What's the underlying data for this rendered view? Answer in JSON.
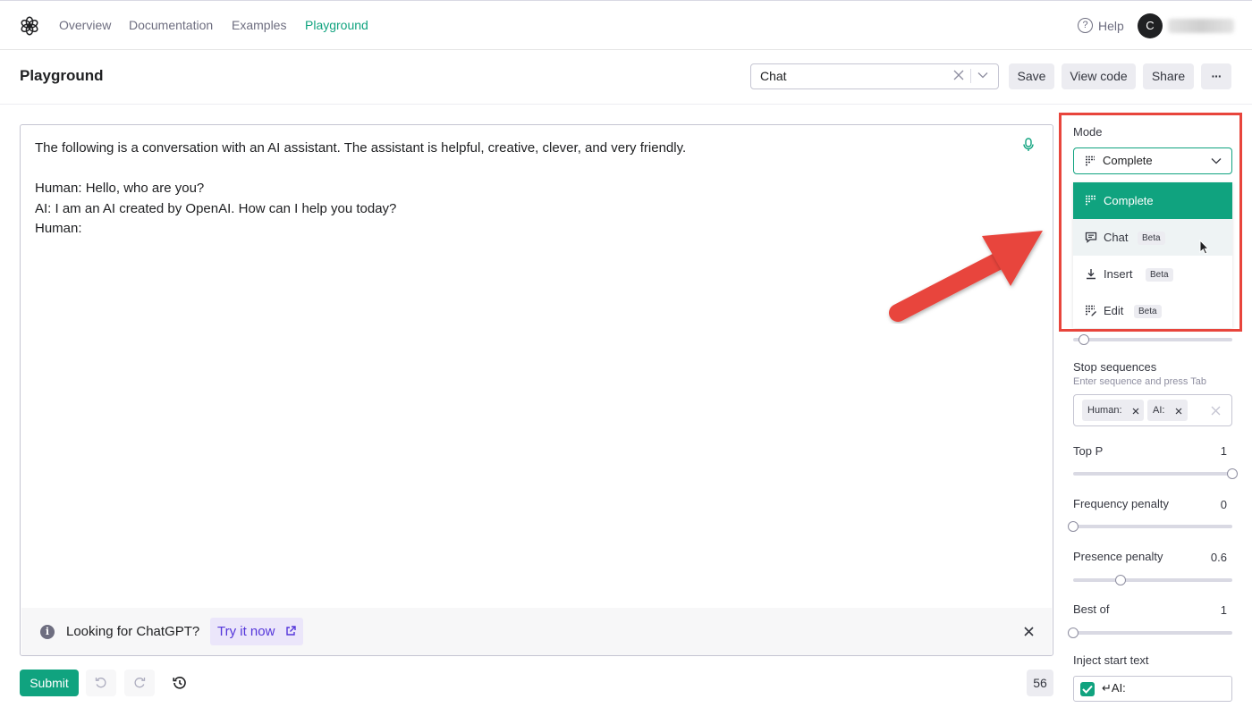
{
  "nav": {
    "links": [
      "Overview",
      "Documentation",
      "Examples",
      "Playground"
    ],
    "active": "Playground",
    "help_label": "Help",
    "avatar_initial": "C"
  },
  "header": {
    "title": "Playground",
    "preset_value": "Chat",
    "save_label": "Save",
    "view_code_label": "View code",
    "share_label": "Share",
    "more_label": "···"
  },
  "editor": {
    "text": "The following is a conversation with an AI assistant. The assistant is helpful, creative, clever, and very friendly.\n\nHuman: Hello, who are you?\nAI: I am an AI created by OpenAI. How can I help you today?\nHuman:"
  },
  "banner": {
    "text": "Looking for ChatGPT?",
    "link_label": "Try it now"
  },
  "footer": {
    "submit_label": "Submit",
    "token_count": "56"
  },
  "settings": {
    "mode_label": "Mode",
    "mode_value": "Complete",
    "mode_options": [
      {
        "label": "Complete",
        "badge": "",
        "icon": "complete-icon",
        "selected": true
      },
      {
        "label": "Chat",
        "badge": "Beta",
        "icon": "chat-icon",
        "selected": false
      },
      {
        "label": "Insert",
        "badge": "Beta",
        "icon": "insert-icon",
        "selected": false
      },
      {
        "label": "Edit",
        "badge": "Beta",
        "icon": "edit-icon",
        "selected": false
      }
    ],
    "stop_sequences_label": "Stop sequences",
    "stop_sequences_hint": "Enter sequence and press Tab",
    "stop_sequences": [
      "Human:",
      "AI:"
    ],
    "top_p": {
      "label": "Top P",
      "value": "1",
      "fraction": 1.0
    },
    "frequency_penalty": {
      "label": "Frequency penalty",
      "value": "0",
      "fraction": 0.0
    },
    "presence_penalty": {
      "label": "Presence penalty",
      "value": "0.6",
      "fraction": 0.3
    },
    "best_of": {
      "label": "Best of",
      "value": "1",
      "fraction": 0.0
    },
    "hidden_slider_fraction": 0.07,
    "inject_start_text": {
      "label": "Inject start text",
      "value": "↵AI:",
      "checked": true
    }
  },
  "colors": {
    "accent": "#10a37f",
    "annotation_red": "#e8453c",
    "link_purple": "#5436da"
  }
}
